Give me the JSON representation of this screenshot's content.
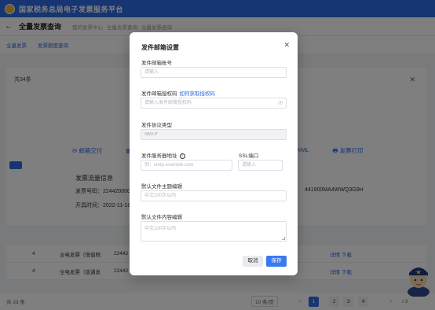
{
  "app": {
    "title": "国家税务总局电子发票服务平台"
  },
  "subheader": {
    "back_icon": "arrow-left-icon",
    "page_title": "全量发票查询",
    "crumbs": [
      "我的发票中心",
      "全量发票查询",
      "全量发票查询"
    ]
  },
  "tabs": [
    "全量发票",
    "发票额度查询"
  ],
  "background_panel": {
    "header": "共34条",
    "actions_left": [
      "邮箱交付",
      "二"
    ],
    "actions_right": [
      "XML",
      "发票打印"
    ],
    "summary_title": "发票流量信息",
    "invoice_no_label": "发票号码：",
    "invoice_no_value": "2244200000009",
    "issue_time_label": "开具时间：",
    "issue_time_value": "2022-11-18 16",
    "taxpayer_id_partial": "441900MA4WWQ3G9H",
    "rows": [
      {
        "index": "4",
        "type": "全电发票（增值税",
        "number": "22442",
        "ops": [
          "详情",
          "下载"
        ]
      },
      {
        "index": "4",
        "type": "全电发票（普通发",
        "number": "22442",
        "ops": [
          "详情",
          "下载"
        ]
      }
    ]
  },
  "pagination": {
    "total": "共 33 条",
    "page_size": "10 条/页",
    "prev": "<",
    "pages": [
      "1",
      "2",
      "3",
      "4"
    ],
    "active_page": "1",
    "next": ">",
    "goto": "/ 3"
  },
  "dialog": {
    "title": "发件邮箱设置",
    "close_icon": "close-icon",
    "account_label": "发件邮箱账号",
    "account_placeholder": "请输入",
    "auth_label": "发件邮箱授权码",
    "auth_link": "如何获取授权码",
    "auth_placeholder": "请输入发件邮箱授权码",
    "eye_icon": "eye-icon",
    "protocol_label": "发件协议类型",
    "protocol_value": "SMTP",
    "server_label": "发件服务器地址",
    "server_info_icon": "info-icon",
    "server_placeholder": "例：smtp.example.com",
    "ssl_label": "SSL端口",
    "ssl_placeholder": "请输入",
    "subject_label": "默认文件主题编辑",
    "subject_placeholder": "中文100字以内",
    "content_label": "默认文件内容编辑",
    "content_placeholder": "中文100字以内",
    "cancel_label": "取消",
    "save_label": "保存"
  },
  "colors": {
    "primary": "#2d6be4",
    "save_button": "#3a7af0",
    "mask": "rgba(0,0,0,0.5)"
  }
}
